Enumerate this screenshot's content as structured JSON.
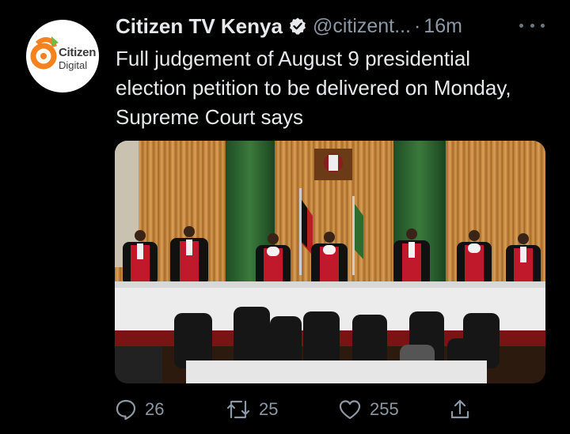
{
  "tweet": {
    "author_name": "Citizen TV Kenya",
    "handle": "@citizent...",
    "separator": "·",
    "time": "16m",
    "text": "Full judgement of August 9 presidential election petition to be delivered on Monday, Supreme Court says",
    "avatar": {
      "line1": "Citizen",
      "line2": "Digital"
    }
  },
  "actions": {
    "replies": "26",
    "retweets": "25",
    "likes": "255"
  },
  "icons": {
    "verified": "verified-badge-icon",
    "more": "more-options-icon",
    "reply": "reply-icon",
    "retweet": "retweet-icon",
    "like": "heart-icon",
    "share": "share-icon"
  },
  "colors": {
    "background": "#000000",
    "text": "#e7e9ea",
    "muted": "#8b98a5",
    "brand_orange": "#f5821f",
    "brand_green": "#6cbd45"
  }
}
